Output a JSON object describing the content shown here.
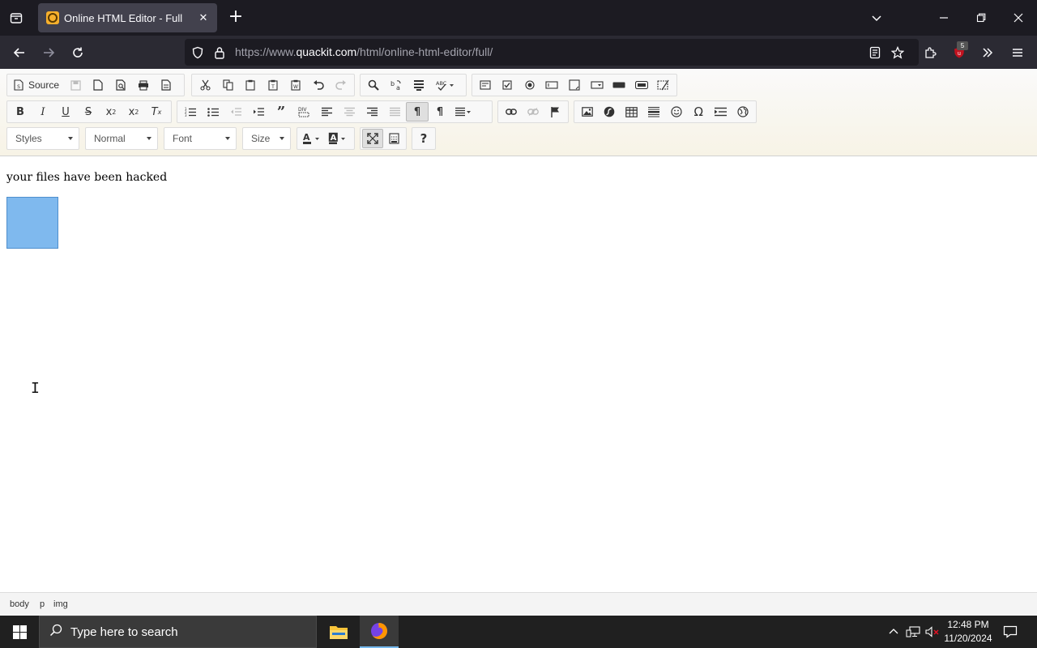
{
  "browser": {
    "tab_title": "Online HTML Editor - Full",
    "url_prefix": "https://www.",
    "url_domain": "quackit.com",
    "url_path": "/html/online-html-editor/full/",
    "extension_badge": "5"
  },
  "toolbar": {
    "source_label": "Source",
    "styles_label": "Styles",
    "format_label": "Normal",
    "font_label": "Font",
    "size_label": "Size",
    "help_label": "?"
  },
  "content": {
    "text": "your files have been hacked",
    "image_fill_color": "#7fb9ee"
  },
  "elements_path": [
    "body",
    "p",
    "img"
  ],
  "taskbar": {
    "search_placeholder": "Type here to search",
    "time": "12:48 PM",
    "date": "11/20/2024"
  }
}
